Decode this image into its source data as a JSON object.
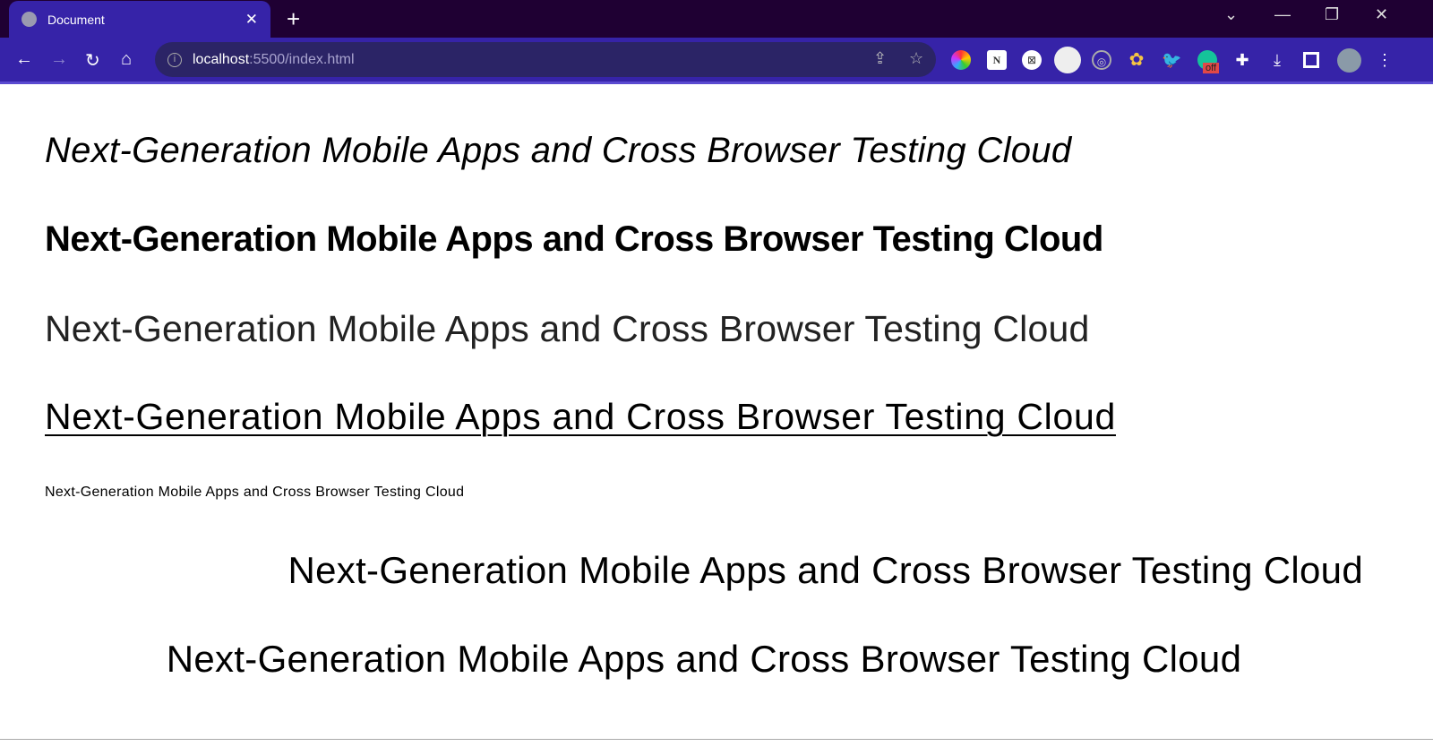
{
  "browser": {
    "tab_title": "Document",
    "url_host": "localhost",
    "url_path": ":5500/index.html",
    "extensions": [
      "colorzilla-icon",
      "notion-icon",
      "extension-icon",
      "react-icon",
      "target-icon",
      "react-devtools-icon",
      "twitter-icon",
      "grammarly-icon",
      "puzzle-icon"
    ],
    "grammarly_badge": "off"
  },
  "page": {
    "lines": [
      "Next-Generation Mobile Apps and Cross Browser Testing Cloud",
      "Next-Generation Mobile Apps and Cross Browser Testing Cloud",
      "Next-Generation Mobile Apps and Cross Browser Testing Cloud",
      "Next-Generation Mobile Apps and Cross Browser Testing Cloud",
      "Next-Generation Mobile Apps and Cross Browser Testing Cloud",
      "Next-Generation Mobile Apps and Cross Browser Testing Cloud",
      "Next-Generation Mobile Apps and Cross Browser Testing Cloud"
    ]
  }
}
